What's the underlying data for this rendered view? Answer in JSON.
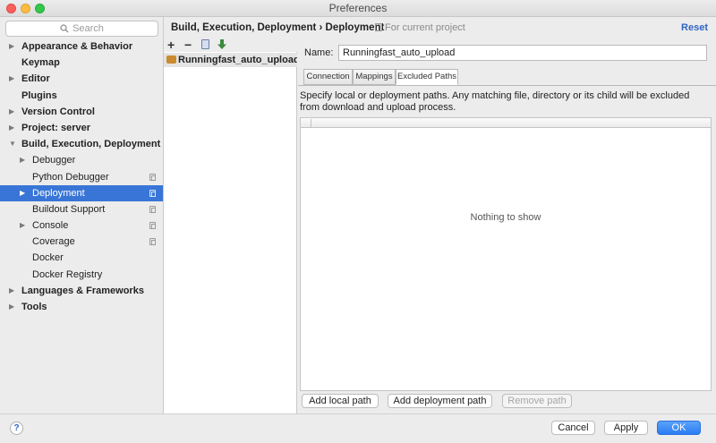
{
  "window": {
    "title": "Preferences"
  },
  "search": {
    "placeholder": "Search"
  },
  "sidebar": {
    "items": [
      {
        "label": "Appearance & Behavior",
        "has_arrow": true,
        "expanded": false,
        "level": 0,
        "bold": true,
        "selected": false,
        "has_copy": false
      },
      {
        "label": "Keymap",
        "has_arrow": false,
        "expanded": false,
        "level": 0,
        "bold": true,
        "selected": false,
        "has_copy": false
      },
      {
        "label": "Editor",
        "has_arrow": true,
        "expanded": false,
        "level": 0,
        "bold": true,
        "selected": false,
        "has_copy": false
      },
      {
        "label": "Plugins",
        "has_arrow": false,
        "expanded": false,
        "level": 0,
        "bold": true,
        "selected": false,
        "has_copy": false
      },
      {
        "label": "Version Control",
        "has_arrow": true,
        "expanded": false,
        "level": 0,
        "bold": true,
        "selected": false,
        "has_copy": false
      },
      {
        "label": "Project: server",
        "has_arrow": true,
        "expanded": false,
        "level": 0,
        "bold": true,
        "selected": false,
        "has_copy": false
      },
      {
        "label": "Build, Execution, Deployment",
        "has_arrow": true,
        "expanded": true,
        "level": 0,
        "bold": true,
        "selected": false,
        "has_copy": false
      },
      {
        "label": "Debugger",
        "has_arrow": true,
        "expanded": false,
        "level": 1,
        "bold": false,
        "selected": false,
        "has_copy": false
      },
      {
        "label": "Python Debugger",
        "has_arrow": false,
        "expanded": false,
        "level": 1,
        "bold": false,
        "selected": false,
        "has_copy": true
      },
      {
        "label": "Deployment",
        "has_arrow": true,
        "expanded": false,
        "level": 1,
        "bold": false,
        "selected": true,
        "has_copy": true
      },
      {
        "label": "Buildout Support",
        "has_arrow": false,
        "expanded": false,
        "level": 1,
        "bold": false,
        "selected": false,
        "has_copy": true
      },
      {
        "label": "Console",
        "has_arrow": true,
        "expanded": false,
        "level": 1,
        "bold": false,
        "selected": false,
        "has_copy": true
      },
      {
        "label": "Coverage",
        "has_arrow": false,
        "expanded": false,
        "level": 1,
        "bold": false,
        "selected": false,
        "has_copy": true
      },
      {
        "label": "Docker",
        "has_arrow": false,
        "expanded": false,
        "level": 1,
        "bold": false,
        "selected": false,
        "has_copy": false
      },
      {
        "label": "Docker Registry",
        "has_arrow": false,
        "expanded": false,
        "level": 1,
        "bold": false,
        "selected": false,
        "has_copy": false
      },
      {
        "label": "Languages & Frameworks",
        "has_arrow": true,
        "expanded": false,
        "level": 0,
        "bold": true,
        "selected": false,
        "has_copy": false
      },
      {
        "label": "Tools",
        "has_arrow": true,
        "expanded": false,
        "level": 0,
        "bold": true,
        "selected": false,
        "has_copy": false
      }
    ]
  },
  "header": {
    "breadcrumb": "Build, Execution, Deployment › Deployment",
    "scope": "For current project",
    "reset": "Reset"
  },
  "toolbar": {
    "add": "+",
    "remove": "−"
  },
  "servers": [
    {
      "name": "Runningfast_auto_upload"
    }
  ],
  "form": {
    "name_label": "Name:",
    "name_value": "Runningfast_auto_upload"
  },
  "tabs": [
    {
      "label": "Connection",
      "active": false
    },
    {
      "label": "Mappings",
      "active": false
    },
    {
      "label": "Excluded Paths",
      "active": true
    }
  ],
  "excluded": {
    "description": "Specify local or deployment paths. Any matching file, directory or its child will be excluded from download and upload process.",
    "empty_text": "Nothing to show",
    "buttons": {
      "add_local": "Add local path",
      "add_deployment": "Add deployment path",
      "remove": "Remove path"
    }
  },
  "footer": {
    "help": "?",
    "cancel": "Cancel",
    "apply": "Apply",
    "ok": "OK"
  }
}
